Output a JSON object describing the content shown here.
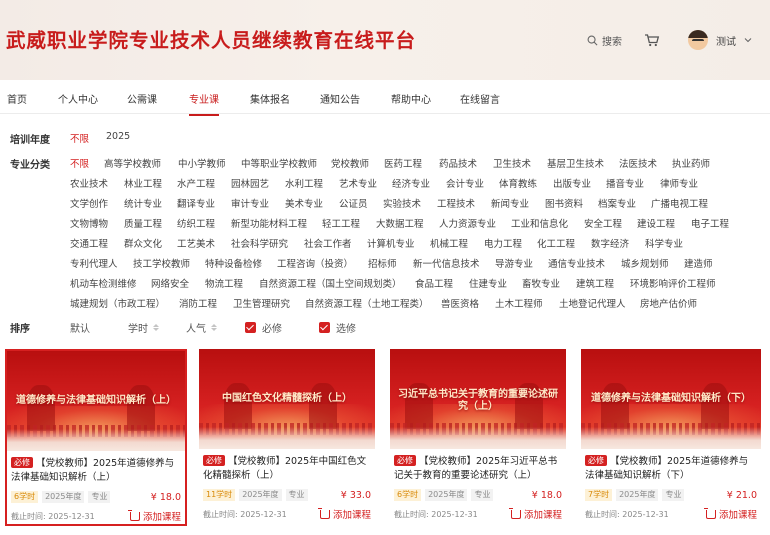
{
  "site_title": "武威职业学院专业技术人员继续教育在线平台",
  "header": {
    "search_label": "搜索",
    "user_name": "测试"
  },
  "colors": {
    "brand_red": "#c81c1c",
    "accent": "#d42121",
    "hours_bg": "#fdf1d6"
  },
  "icons": [
    "search-icon",
    "cart-icon",
    "avatar",
    "chevron-down-icon",
    "add-cart-icon",
    "checkbox-icon",
    "sort-arrow-icon"
  ],
  "nav": [
    "首页",
    "个人中心",
    "公需课",
    "专业课",
    "集体报名",
    "通知公告",
    "帮助中心",
    "在线留言"
  ],
  "nav_active": "专业课",
  "filters": {
    "year_label": "培训年度",
    "years": [
      "不限",
      "2025"
    ],
    "category_label": "专业分类",
    "category_rows": [
      [
        "不限",
        "高等学校教师",
        "中小学教师",
        "中等职业学校教师",
        "党校教师",
        "医药工程",
        "药品技术",
        "卫生技术",
        "基层卫生技术",
        "法医技术",
        "执业药师"
      ],
      [
        "农业技术",
        "林业工程",
        "水产工程",
        "园林园艺",
        "水利工程",
        "艺术专业",
        "经济专业",
        "会计专业",
        "体育教练",
        "出版专业",
        "播音专业",
        "律师专业"
      ],
      [
        "文学创作",
        "统计专业",
        "翻译专业",
        "审计专业",
        "美术专业",
        "公证员",
        "实验技术",
        "工程技术",
        "新闻专业",
        "图书资料",
        "档案专业",
        "广播电视工程"
      ],
      [
        "文物博物",
        "质量工程",
        "纺织工程",
        "新型功能材料工程",
        "轻工工程",
        "大数据工程",
        "人力资源专业",
        "工业和信息化",
        "安全工程",
        "建设工程",
        "电子工程"
      ],
      [
        "交通工程",
        "群众文化",
        "工艺美术",
        "社会科学研究",
        "社会工作者",
        "计算机专业",
        "机械工程",
        "电力工程",
        "化工工程",
        "数字经济",
        "科学专业"
      ],
      [
        "专利代理人",
        "技工学校教师",
        "特种设备检修",
        "工程咨询（投资）",
        "招标师",
        "新一代信息技术",
        "导游专业",
        "通信专业技术",
        "城乡规划师",
        "建造师"
      ],
      [
        "机动车检测维修",
        "网络安全",
        "物流工程",
        "自然资源工程（国土空间规划类）",
        "食品工程",
        "住建专业",
        "畜牧专业",
        "建筑工程",
        "环境影响评价工程师"
      ],
      [
        "城建规划（市政工程）",
        "消防工程",
        "卫生管理研究",
        "自然资源工程（土地工程类）",
        "兽医资格",
        "土木工程师",
        "土地登记代理人",
        "房地产估价师"
      ]
    ]
  },
  "sort": {
    "label": "排序",
    "default": "默认",
    "hours": "学时",
    "popularity": "人气",
    "required": "必修",
    "elective": "选修"
  },
  "courses": [
    {
      "banner": "道德修养与法律基础知识解析（上）",
      "tag": "必修",
      "title": "【党校教师】2025年道德修养与法律基础知识解析（上）",
      "hours": "6学时",
      "year": "2025年度",
      "type": "专业",
      "price": "¥ 18.0",
      "deadline": "截止时间: 2025-12-31",
      "add": "添加课程"
    },
    {
      "banner": "中国红色文化精髓探析（上）",
      "tag": "必修",
      "title": "【党校教师】2025年中国红色文化精髓探析（上）",
      "hours": "11学时",
      "year": "2025年度",
      "type": "专业",
      "price": "¥ 33.0",
      "deadline": "截止时间: 2025-12-31",
      "add": "添加课程"
    },
    {
      "banner": "习近平总书记关于教育的重要论述研究（上）",
      "tag": "必修",
      "title": "【党校教师】2025年习近平总书记关于教育的重要论述研究（上）",
      "hours": "6学时",
      "year": "2025年度",
      "type": "专业",
      "price": "¥ 18.0",
      "deadline": "截止时间: 2025-12-31",
      "add": "添加课程"
    },
    {
      "banner": "道德修养与法律基础知识解析（下）",
      "tag": "必修",
      "title": "【党校教师】2025年道德修养与法律基础知识解析（下）",
      "hours": "7学时",
      "year": "2025年度",
      "type": "专业",
      "price": "¥ 21.0",
      "deadline": "截止时间: 2025-12-31",
      "add": "添加课程"
    }
  ]
}
